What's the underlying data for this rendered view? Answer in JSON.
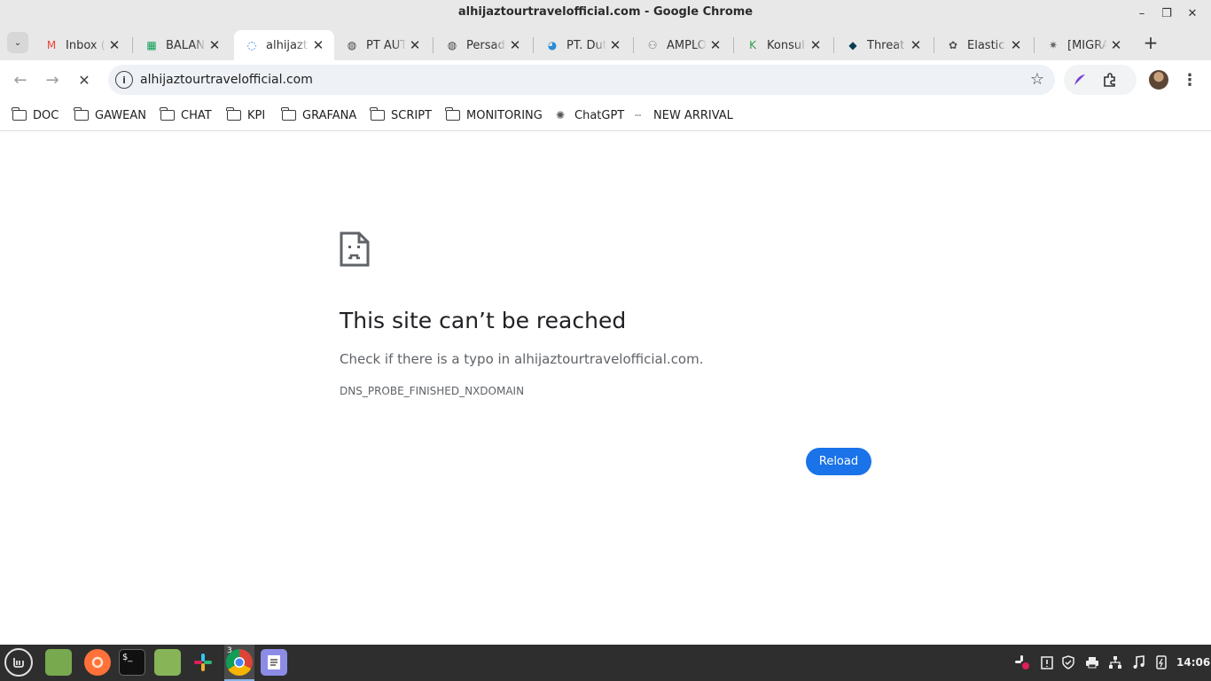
{
  "window": {
    "title": "alhijaztourtravelofficial.com - Google Chrome",
    "minimize": "–",
    "maximize": "❐",
    "close": "✕"
  },
  "tabs": [
    {
      "label": "Inbox (",
      "icon": "gmail-icon",
      "glyph": "M",
      "color": "#ea4335",
      "active": false
    },
    {
      "label": "BALAN",
      "icon": "sheets-icon",
      "glyph": "▦",
      "color": "#0f9d58",
      "active": false
    },
    {
      "label": "alhijazt",
      "icon": "loading-spinner-icon",
      "glyph": "◌",
      "color": "#1a73e8",
      "active": true
    },
    {
      "label": "PT AUT",
      "icon": "globe-icon",
      "glyph": "◍",
      "color": "#444444",
      "active": false
    },
    {
      "label": "Persad",
      "icon": "globe-icon",
      "glyph": "◍",
      "color": "#444444",
      "active": false
    },
    {
      "label": "PT. Dut",
      "icon": "site-logo-icon",
      "glyph": "◕",
      "color": "#2a8bd6",
      "active": false
    },
    {
      "label": "AMPLO",
      "icon": "site-logo-icon",
      "glyph": "⚇",
      "color": "#777777",
      "active": false
    },
    {
      "label": "Konsul",
      "icon": "site-logo-icon",
      "glyph": "K",
      "color": "#2e9d4a",
      "active": false
    },
    {
      "label": "Threat",
      "icon": "shield-icon",
      "glyph": "◆",
      "color": "#0b3b52",
      "active": false
    },
    {
      "label": "Elastic",
      "icon": "elastic-icon",
      "glyph": "✿",
      "color": "#555555",
      "active": false
    },
    {
      "label": "[MIGRA",
      "icon": "gear-icon",
      "glyph": "✷",
      "color": "#666666",
      "active": false
    }
  ],
  "tab_close_glyph": "✕",
  "new_tab_glyph": "+",
  "tab_search_glyph": "⌄",
  "toolbar": {
    "back": "←",
    "forward": "→",
    "stop": "✕",
    "url": "alhijaztourtravelofficial.com",
    "info_glyph": "i",
    "star": "☆",
    "menu": "⋮"
  },
  "bookmarks": [
    {
      "label": "DOC",
      "type": "folder"
    },
    {
      "label": "GAWEAN",
      "type": "folder"
    },
    {
      "label": "CHAT",
      "type": "folder"
    },
    {
      "label": "KPI",
      "type": "folder"
    },
    {
      "label": "GRAFANA",
      "type": "folder"
    },
    {
      "label": "SCRIPT",
      "type": "folder"
    },
    {
      "label": "MONITORING",
      "type": "folder"
    },
    {
      "label": "ChatGPT",
      "type": "link",
      "glyph": "✺"
    },
    {
      "label": "NEW ARRIVAL",
      "type": "link",
      "glyph": "┄"
    }
  ],
  "error": {
    "title": "This site can’t be reached",
    "description": "Check if there is a typo in alhijaztourtravelofficial.com.",
    "code": "DNS_PROBE_FINISHED_NXDOMAIN",
    "reload_label": "Reload"
  },
  "taskbar": {
    "chrome_badge": "3",
    "terminal_glyph": "$_",
    "clock": "14:06"
  }
}
